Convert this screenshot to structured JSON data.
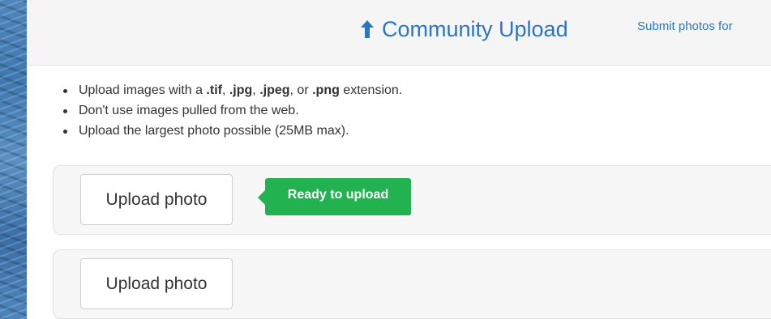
{
  "header": {
    "title": "Community Upload",
    "title_icon": "upload-arrow-icon",
    "link_text": "Submit photos for",
    "accent_color": "#2a76c4",
    "background_color": "#f5f5f5"
  },
  "rules": {
    "items": [
      {
        "parts": [
          {
            "text": "Upload images with a ",
            "bold": false
          },
          {
            "text": ".tif",
            "bold": true
          },
          {
            "text": ", ",
            "bold": false
          },
          {
            "text": ".jpg",
            "bold": true
          },
          {
            "text": ", ",
            "bold": false
          },
          {
            "text": ".jpeg",
            "bold": true
          },
          {
            "text": ", or ",
            "bold": false
          },
          {
            "text": ".png",
            "bold": true
          },
          {
            "text": " extension.",
            "bold": false
          }
        ]
      },
      {
        "parts": [
          {
            "text": "Don't use images pulled from the web.",
            "bold": false
          }
        ]
      },
      {
        "parts": [
          {
            "text": "Upload the largest photo possible (25MB max).",
            "bold": false
          }
        ]
      }
    ]
  },
  "uploads": [
    {
      "button_label": "Upload photo",
      "status": "Ready to upload",
      "status_color": "#22b250"
    },
    {
      "button_label": "Upload photo"
    }
  ]
}
